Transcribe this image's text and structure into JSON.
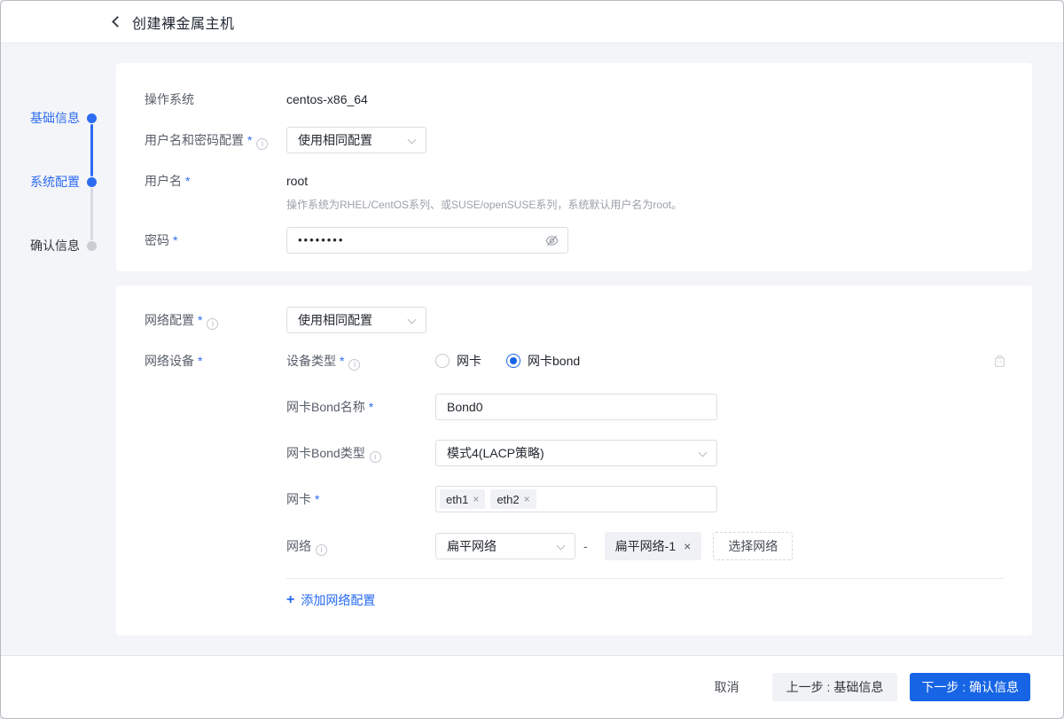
{
  "header": {
    "title": "创建裸金属主机"
  },
  "steps": [
    {
      "label": "基础信息",
      "state": "done"
    },
    {
      "label": "系统配置",
      "state": "active"
    },
    {
      "label": "确认信息",
      "state": "pending"
    }
  ],
  "icons": {
    "close": "×",
    "info": "i",
    "plus": "+",
    "password_dots": "••••••••"
  },
  "misc": {
    "required_mark": "*",
    "range_separator": "-"
  },
  "system_card": {
    "os": {
      "label": "操作系统",
      "value": "centos-x86_64"
    },
    "user_pass_config": {
      "label": "用户名和密码配置",
      "value": "使用相同配置"
    },
    "username": {
      "label": "用户名",
      "value": "root",
      "hint": "操作系统为RHEL/CentOS系列、或SUSE/openSUSE系列，系统默认用户名为root。"
    },
    "password": {
      "label": "密码"
    }
  },
  "network_card": {
    "network_config": {
      "label": "网络配置",
      "value": "使用相同配置"
    },
    "network_device": {
      "label": "网络设备"
    },
    "device_type": {
      "label": "设备类型",
      "options": [
        {
          "label": "网卡",
          "selected": false
        },
        {
          "label": "网卡bond",
          "selected": true
        }
      ]
    },
    "bond_name": {
      "label": "网卡Bond名称",
      "value": "Bond0"
    },
    "bond_type": {
      "label": "网卡Bond类型",
      "value": "模式4(LACP策略)"
    },
    "nic": {
      "label": "网卡",
      "tags": [
        "eth1",
        "eth2"
      ]
    },
    "network": {
      "label": "网络",
      "selected": "扁平网络",
      "tag": "扁平网络-1",
      "choose_button": "选择网络"
    },
    "add_link": "添加网络配置"
  },
  "footer": {
    "cancel": "取消",
    "prev": "上一步 : 基础信息",
    "next": "下一步 : 确认信息"
  },
  "colors": {
    "primary": "#1765e5",
    "link": "#2468f2",
    "body_bg": "#f4f5f8"
  }
}
